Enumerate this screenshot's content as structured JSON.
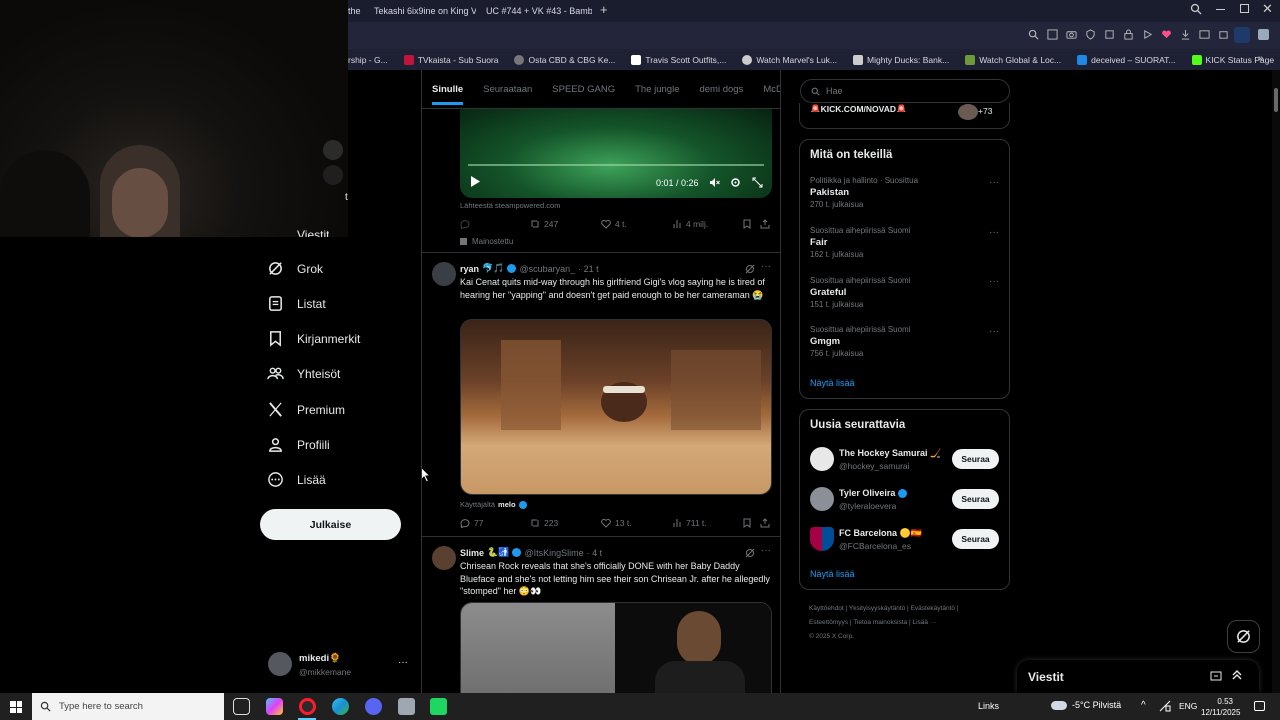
{
  "browser": {
    "tabs": [
      {
        "label": "the",
        "color": "#ffffff"
      },
      {
        "label": "Tekashi 6ix9ine on King V...",
        "color": "#ff0033"
      },
      {
        "label": "UC #744 + VK #43 - Bamb...",
        "color": "#1db954"
      }
    ],
    "bookmarks": [
      {
        "label": "rship - G...",
        "color": "#555"
      },
      {
        "label": "TVkaista - Sub Suora",
        "color": "#c0143c"
      },
      {
        "label": "Osta CBD & CBG Ke...",
        "color": "#777"
      },
      {
        "label": "Travis Scott Outfits,...",
        "color": "#ffffff"
      },
      {
        "label": "Watch Marvel's Luk...",
        "color": "#cccccc"
      },
      {
        "label": "Mighty Ducks: Bank...",
        "color": "#cccccc"
      },
      {
        "label": "Watch Global & Loc...",
        "color": "#6c9a3b"
      },
      {
        "label": "deceived – SUORAT...",
        "color": "#1e88e5"
      },
      {
        "label": "KICK Status Page",
        "color": "#53fc18"
      }
    ]
  },
  "webcam": {
    "partial_label": "t"
  },
  "nav": {
    "partial_item": "Viestit",
    "items": [
      {
        "label": "Grok",
        "icon": "grok-icon"
      },
      {
        "label": "Listat",
        "icon": "list-icon"
      },
      {
        "label": "Kirjanmerkit",
        "icon": "bookmark-icon"
      },
      {
        "label": "Yhteisöt",
        "icon": "communities-icon"
      },
      {
        "label": "Premium",
        "icon": "x-logo-icon"
      },
      {
        "label": "Profiili",
        "icon": "profile-icon"
      },
      {
        "label": "Lisää",
        "icon": "more-circle-icon"
      }
    ],
    "post_button": "Julkaise",
    "account": {
      "name": "mikedi",
      "emoji": "🌻",
      "handle": "@mikkemane"
    }
  },
  "feed": {
    "tabs": [
      "Sinulle",
      "Seuraataan",
      "SPEED GANG",
      "The jungle",
      "demi dogs",
      "McDonald"
    ],
    "ad": {
      "video_time": "0:01 / 0:26",
      "source": "Lähteestä steampowered.com",
      "reposts": "247",
      "likes": "4 t.",
      "views": "4 milj.",
      "promoted": "Mainostettu"
    },
    "posts": [
      {
        "name": "ryan",
        "badges": "🐬🎵",
        "handle": "@scubaryan_",
        "time": "· 21 t",
        "text": "Kai Cenat quits mid-way through his girlfriend Gigi's vlog saying he is tired of hearing her \"yapping\" and doesn't get paid enough to be her cameraman 😭",
        "media_credit_prefix": "Käyttäjältä",
        "media_credit_user": "melo",
        "replies": "77",
        "reposts": "223",
        "likes": "13 t.",
        "views": "711 t."
      },
      {
        "name": "Slime",
        "badges": "🐍🚮",
        "handle": "@ItsKingSlime",
        "time": "· 4 t",
        "text": "Chrisean Rock reveals that she's officially DONE with her Baby Daddy Blueface and she's not letting him see their son Chrisean Jr. after he allegedly \"stomped\" her 😳👀"
      }
    ]
  },
  "right": {
    "search_placeholder": "Hae",
    "live_banner": "🚨KICK.COM/NOVAD🚨",
    "live_count": "+73",
    "trends_title": "Mitä on tekeillä",
    "trends": [
      {
        "context": "Politiikka ja hallinto · Suosittua",
        "name": "Pakistan",
        "count": "270 t. julkaisua"
      },
      {
        "context": "Suosittua aihepiirissä Suomi",
        "name": "Fair",
        "count": "162 t. julkaisua"
      },
      {
        "context": "Suosittua aihepiirissä Suomi",
        "name": "Grateful",
        "count": "151 t. julkaisua"
      },
      {
        "context": "Suosittua aihepiirissä Suomi",
        "name": "Gmgm",
        "count": "756 t. julkaisua"
      }
    ],
    "show_more": "Näytä lisää",
    "follow_title": "Uusia seurattavia",
    "follow": [
      {
        "name": "The Hockey Samurai 🏒",
        "handle": "@hockey_samurai",
        "button": "Seuraa",
        "avatar_color": "#e8e8e8"
      },
      {
        "name": "Tyler Oliveira",
        "handle": "@tyleraloevera",
        "button": "Seuraa",
        "avatar_color": "#8a8f98"
      },
      {
        "name": "FC Barcelona 🟡🇪🇸",
        "handle": "@FCBarcelona_es",
        "button": "Seuraa",
        "avatar_color": "#a50044"
      }
    ],
    "footer": [
      "Käyttöehdot",
      "Yksityisyyskäytäntö",
      "Evästekäytäntö",
      "Esteettömyys",
      "Tietoa mainoksista",
      "Lisää ···",
      "© 2025 X Corp."
    ],
    "messages_label": "Viestit"
  },
  "taskbar": {
    "search_placeholder": "Type here to search",
    "links": "Links",
    "weather": "-5°C  Pilvistä",
    "lang": "ENG",
    "time": "0.53",
    "date": "12/11/2025"
  }
}
